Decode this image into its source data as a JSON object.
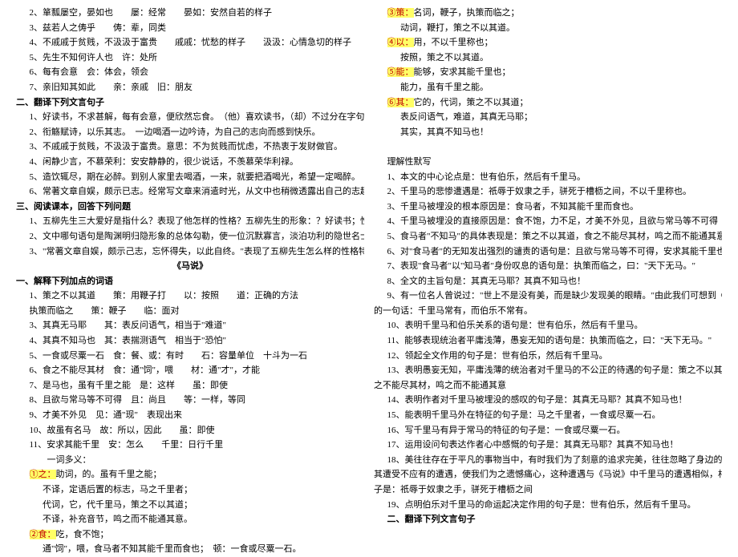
{
  "left": {
    "l1": "2、箪瓢屡空，晏如也　　屡：经常　　晏如：安然自若的样子",
    "l2": "3、兹若人之俦乎　　俦：辈，同类",
    "l3": "4、不戚戚于贫贱，不汲汲于富贵　　戚戚：忧愁的样子　　汲汲：心情急切的样子",
    "l4": "5、先生不知何许人也　许：处所",
    "l5": "6、每有会意　会：体会，领会",
    "l6": "7、亲旧知其如此　　亲：亲戚　旧：朋友",
    "h1": "二、翻译下列文言句子",
    "t1": "1、好读书，不求甚解，每有会意，便欣然忘食。　（他）喜欢读书，（却）不过分在字句上下功夫；每当对书中意旨有所领会的时候，就高兴得忘了吃饭。",
    "t2": "2、衔觞赋诗，以乐其志。　一边喝酒一边吟诗，为自己的志向而感到快乐。",
    "t3": "3、不戚戚于贫贱，不汲汲于富贵。意思：不为贫贱而忧虑，不热衷于发财做官。",
    "t4": "4、闲静少言，不慕荣利：安安静静的，很少说话，不羡慕荣华利禄。",
    "t5": "5、造饮辄尽，期在必醉。到别人家里去喝酒，一来，就要把酒喝光，希望一定喝醉。",
    "t6": "6、常著文章自娱，颇示已志。经常写文章来消遣时光，从文中也稍微透露出自己的志趣。",
    "h2": "三、阅读课本，回答下列问题",
    "q1": "1、五柳先生三大爱好是指什么？表现了他怎样的性格？五柳先生的形象：？好读书；性嗜酒；常著文章自娱。　平和、旷达的性格。安贫乐道，不慕荣利，独立于世的隐士形象。",
    "q2": "2、文中哪句语句是陶渊明归隐形象的总体勾勒，使一位沉默寡言，淡泊功利的隐世名士飘然而生。闲静少言，不慕荣利。",
    "q3": "3、\"常著文章自娱，颇示己志，忘怀得失，以此自终。\"表现了五柳先生怎么样的性格特点？　自得其乐，淡泊名利。",
    "title": "《马说》",
    "h3": "一、解释下列加点的词语",
    "c1": "1、策之不以其道　　策：用鞭子打　　以：按照　　道：正确的方法",
    "c2": "执策而临之　　策：鞭子　　临：面对",
    "c3": "3、其真无马耶　　其：表反问语气，相当于\"难道\"",
    "c4": "4、其真不知马也　其：表揣测语气　相当于\"恐怕\"",
    "c5": "5、一食或尽粟一石　食：餐、或：有时　　石：容量单位　十斗为一石",
    "c6": "6、食之不能尽其材　食：通\"饲\"，喂　　材：通\"才\"，才能",
    "c7": "7、是马也，虽有千里之能　是：这样　　虽：即使",
    "c8": "8、且欲与常马等不可得　且：尚且　　等：一样，等同",
    "c9": "9、才美不外见　见：通\"现\"　表现出来",
    "c10": "10、故虽有名马　故：所以，因此　　虽：即使",
    "c11": "11、安求其能千里　安：怎么　　千里：日行千里",
    "cext": "　　一词多义：",
    "z1a": "①之：",
    "z1b": "助词，的。虽有千里之能；",
    "z1c": "不译，定语后置的标志，马之千里者；",
    "z1d": "代词，它，代千里马，策之不以其道；",
    "z1e": "不译，补充音节，鸣之而不能通其意。",
    "z2a": "②食：",
    "z2b": "吃，食不饱；",
    "z2c": "通\"饲\"，喂，食马者不知其能千里而食也；　顿：一食或尽粟一石。"
  },
  "right": {
    "r1a": "③策：",
    "r1b": "名词，鞭子，执策而临之；",
    "r1c": "动词，鞭打，策之不以其道。",
    "r2a": "④以：",
    "r2b": "用，不以千里称也；",
    "r2c": "按照，策之不以其道。",
    "r3a": "⑤能：",
    "r3b": "能够，安求其能千里也；",
    "r3c": "能力，虽有千里之能。",
    "r4a": "⑥其：",
    "r4b": "它的，代词，策之不以其道；",
    "r4c": "表反问语气，难道，其真无马耶；",
    "r4d": "其实，其真不知马也！",
    "rh1": "理解性默写",
    "d1": "1、本文的中心论点是：世有伯乐，然后有千里马。",
    "d2": "2、千里马的悲惨遭遇是：祇辱于奴隶之手，骈死于槽枥之间，不以千里称也。",
    "d3": "3、千里马被埋没的根本原因是：食马者，不知其能千里而食也。",
    "d4": "4、千里马被埋没的直接原因是：食不饱，力不足，才美不外见，且欲与常马等不可得",
    "d5": "5、食马者\"不知马\"的具体表现是：策之不以其道，食之不能尽其材，鸣之而不能通其意",
    "d6": "6、对\"食马者\"的无知发出强烈的谴责的语句是：且欲与常马等不可得，安求其能千里也。",
    "d7": "7、表现\"食马者\"以\"知马者\"身份叹息的语句是：执策而临之，曰：\"天下无马。\"",
    "d8": "8、全文的主旨句是：其真无马耶？其真不知马也！",
    "d9": "9、有一位名人曾说过：\"世上不是没有美，而是缺少发现美的眼睛。\"由此我们可想到《马说》",
    "d9b": "的一句话：千里马常有，而伯乐不常有。",
    "d10": "10、表明千里马和伯乐关系的语句是：世有伯乐，然后有千里马。",
    "d11": "11、能够表现统治者平庸浅薄，愚妄无知的语句是：执策而临之，曰：\"天下无马。\"",
    "d12": "12、领起全文作用的句子是：世有伯乐，然后有千里马。",
    "d13": "13、表明愚妄无知，平庸浅薄的统治者对千里马的不公正的待遇的句子是：策之不以其道，食",
    "d13b": "之不能尽其材，鸣之而不能通其意",
    "d14": "14、表明作者对千里马被埋没的感叹的句子是：其真无马耶？其真不知马也！",
    "d15": "15、能表明千里马外在特征的句子是：马之千里者，一食或尽粟一石。",
    "d16": "16、写千里马有异于常马的特征的句子是：一食或尽粟一石。",
    "d17": "17、运用设问句表达作者心中感慨的句子是：其真无马耶？其真不知马也！",
    "d18": "18、美往往存在于平凡的事物当中，有时我们为了刻意的追求完美，往往忽略了身边的美，使",
    "d18b": "其遭受不应有的遭遇，使我们为之遗憾痛心，这种遭遇与《马说》中千里马的遭遇相似，相应的句",
    "d18c": "子是：祇辱于奴隶之手，骈死于槽枥之间",
    "d19": "19、点明伯乐对千里马的命运起决定作用的句子是：世有伯乐，然后有千里马。",
    "rh2": "二、翻译下列文言句子"
  }
}
